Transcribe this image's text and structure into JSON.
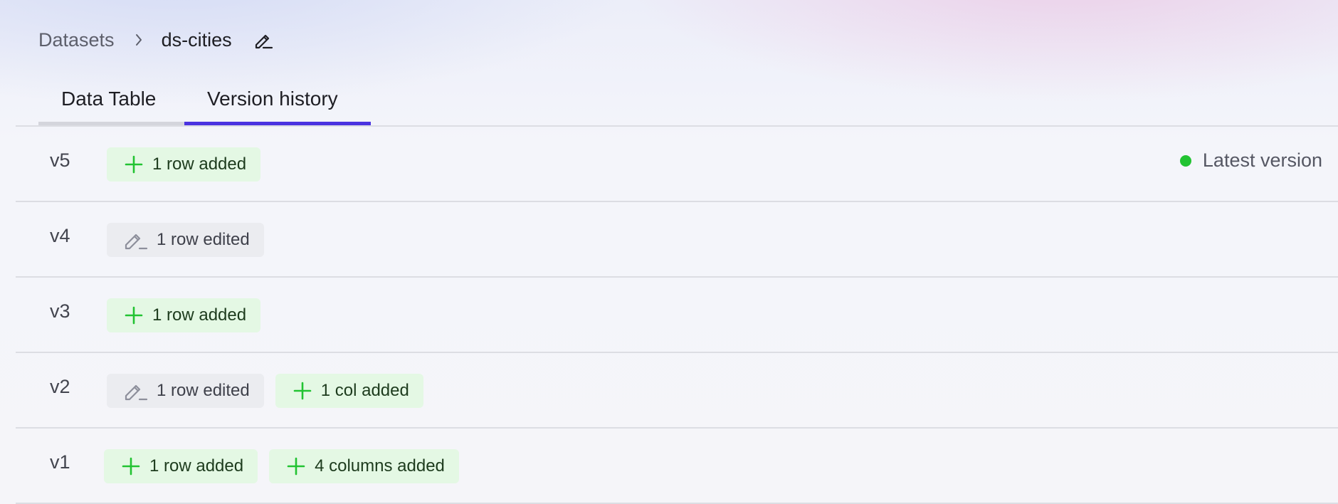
{
  "breadcrumb": {
    "root": "Datasets",
    "current": "ds-cities"
  },
  "tabs": [
    {
      "label": "Data Table",
      "active": false
    },
    {
      "label": "Version history",
      "active": true
    }
  ],
  "colors": {
    "accent": "#4a33e0",
    "added_bg": "#e4f8e4",
    "added_icon": "#22c332",
    "edited_bg": "#ebecf0",
    "latest_dot": "#22c332"
  },
  "versions": [
    {
      "label": "v5",
      "latest": "Latest version",
      "changes": [
        {
          "type": "added",
          "icon": "plus-icon",
          "text": "1 row added"
        }
      ]
    },
    {
      "label": "v4",
      "changes": [
        {
          "type": "edited",
          "icon": "pencil-icon",
          "text": "1 row edited"
        }
      ]
    },
    {
      "label": "v3",
      "changes": [
        {
          "type": "added",
          "icon": "plus-icon",
          "text": "1 row added"
        }
      ]
    },
    {
      "label": "v2",
      "changes": [
        {
          "type": "edited",
          "icon": "pencil-icon",
          "text": "1 row edited"
        },
        {
          "type": "added",
          "icon": "plus-icon",
          "text": "1 col added"
        }
      ]
    },
    {
      "label": "v1",
      "changes": [
        {
          "type": "added",
          "icon": "plus-icon",
          "text": "1 row added"
        },
        {
          "type": "added",
          "icon": "plus-icon",
          "text": "4 columns added"
        }
      ]
    }
  ]
}
